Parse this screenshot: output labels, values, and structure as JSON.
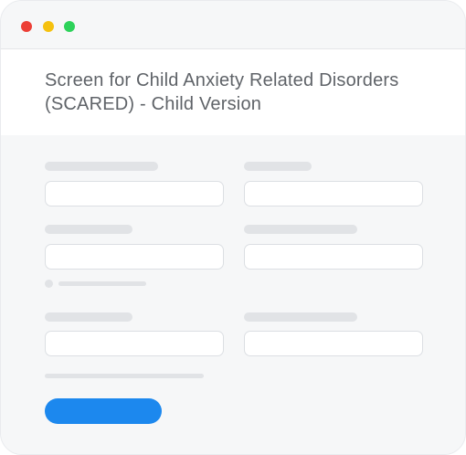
{
  "window": {
    "controls": {
      "close_color": "#ec3f36",
      "minimize_color": "#f5c10f",
      "maximize_color": "#2dd25a"
    }
  },
  "form": {
    "title": "Screen for Child Anxiety Related Disorders (SCARED) - Child Version",
    "submit_button_color": "#1c88ee"
  }
}
